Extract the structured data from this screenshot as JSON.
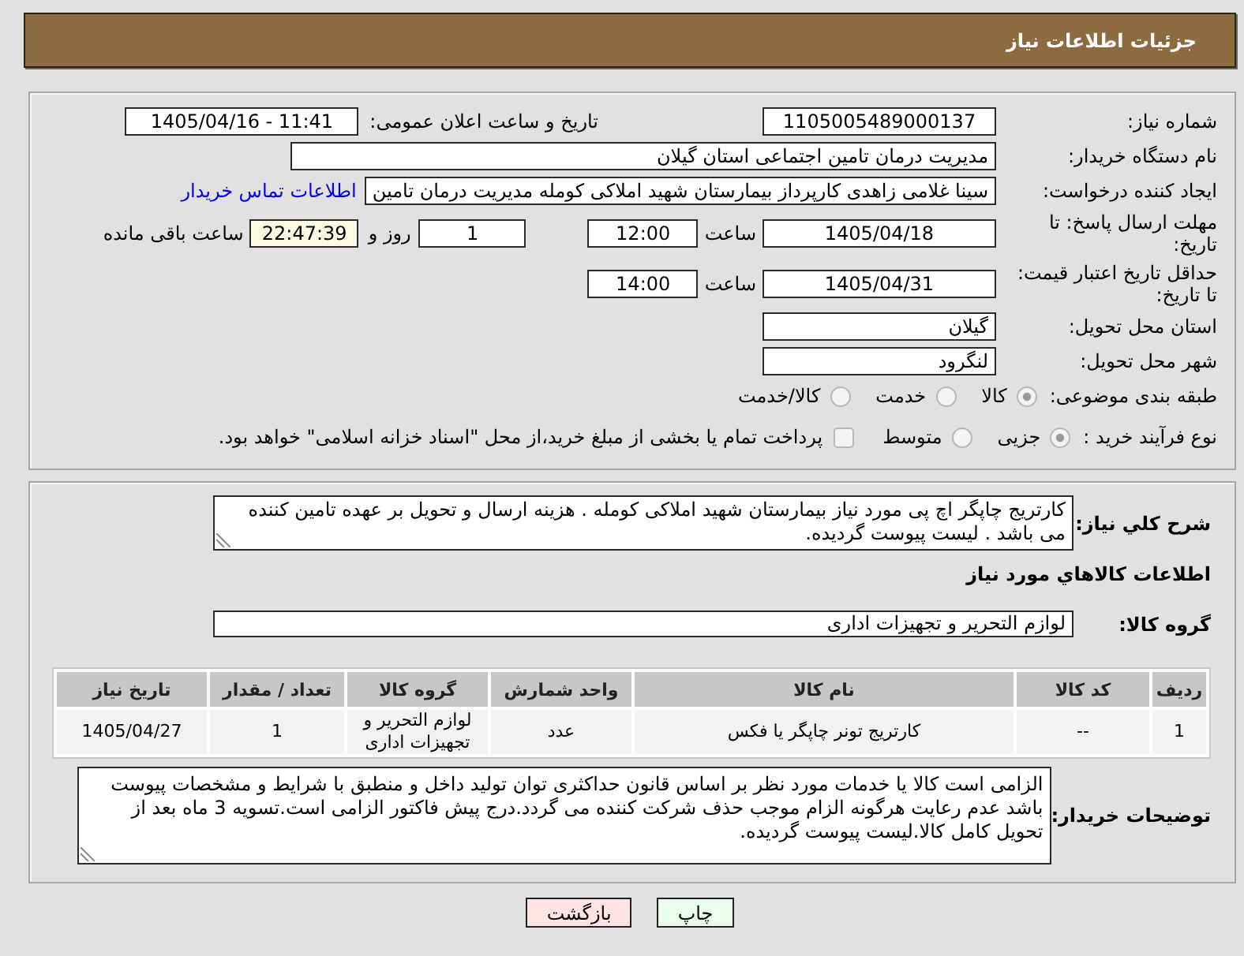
{
  "header": {
    "title": "جزئیات اطلاعات نیاز"
  },
  "details": {
    "need_number": {
      "label": "شماره نیاز:",
      "value": "1105005489000137"
    },
    "announce_date": {
      "label": "تاریخ و ساعت اعلان عمومی:",
      "value": "1405/04/16 - 11:41"
    },
    "buyer_org": {
      "label": "نام دستگاه خریدار:",
      "value": "مدیریت درمان تامین اجتماعی استان گیلان"
    },
    "requester": {
      "label": "ایجاد کننده درخواست:",
      "value": "سینا غلامی زاهدی کارپرداز بیمارستان شهید املاکی کومله مدیریت درمان تامین",
      "link": "اطلاعات تماس خریدار"
    },
    "response_deadline": {
      "label": "مهلت ارسال پاسخ: تا تاریخ:",
      "date": "1405/04/18",
      "time_label": "ساعت",
      "time": "12:00",
      "days": "1",
      "days_label": "روز و",
      "remaining": "22:47:39",
      "remaining_label": "ساعت باقی مانده"
    },
    "price_validity": {
      "label": "حداقل تاریخ اعتبار قیمت: تا تاریخ:",
      "date": "1405/04/31",
      "time_label": "ساعت",
      "time": "14:00"
    },
    "delivery_province": {
      "label": "استان محل تحویل:",
      "value": "گیلان"
    },
    "delivery_city": {
      "label": "شهر محل تحویل:",
      "value": "لنگرود"
    },
    "category": {
      "label": "طبقه بندی موضوعی:",
      "options": [
        {
          "label": "کالا",
          "selected": true
        },
        {
          "label": "خدمت",
          "selected": false
        },
        {
          "label": "کالا/خدمت",
          "selected": false
        }
      ]
    },
    "purchase_process": {
      "label": "نوع فرآیند خرید :",
      "options": [
        {
          "label": "جزیی",
          "selected": true
        },
        {
          "label": "متوسط",
          "selected": false
        }
      ],
      "treasury": {
        "label": "پرداخت تمام یا بخشی از مبلغ خرید،از محل \"اسناد خزانه اسلامی\" خواهد بود.",
        "checked": false
      }
    }
  },
  "goods": {
    "description": {
      "label": "شرح کلي نياز:",
      "text": "کارتریج چاپگر اچ پی مورد نیاز بیمارستان شهید املاکی کومله . هزینه ارسال و تحویل بر عهده تامین کننده می باشد . لیست پیوست گردیده."
    },
    "heading": "اطلاعات کالاهاي مورد نياز",
    "group": {
      "label": "گروه کالا:",
      "value": "لوازم التحریر و تجهیزات اداری"
    },
    "table": {
      "columns": [
        "ردیف",
        "کد کالا",
        "نام کالا",
        "واحد شمارش",
        "گروه کالا",
        "تعداد / مقدار",
        "تاریخ نیاز"
      ],
      "rows": [
        [
          "1",
          "--",
          "کارتریج تونر چاپگر یا فکس",
          "عدد",
          "لوازم التحریر و تجهیزات اداری",
          "1",
          "1405/04/27"
        ]
      ]
    },
    "buyer_notes": {
      "label": "توضیحات خریدار:",
      "text": "الزامی است کالا یا خدمات مورد نظر بر اساس قانون حداکثری توان تولید داخل و منطبق با شرایط و مشخصات پیوست باشد عدم رعایت هرگونه الزام موجب حذف شرکت کننده می گردد.درج پیش فاکتور الزامی است.تسویه 3 ماه بعد از تحویل کامل کالا.لیست پیوست گردیده."
    }
  },
  "buttons": [
    {
      "label": "چاپ",
      "kind": "print"
    },
    {
      "label": "بازگشت",
      "kind": "back"
    }
  ]
}
